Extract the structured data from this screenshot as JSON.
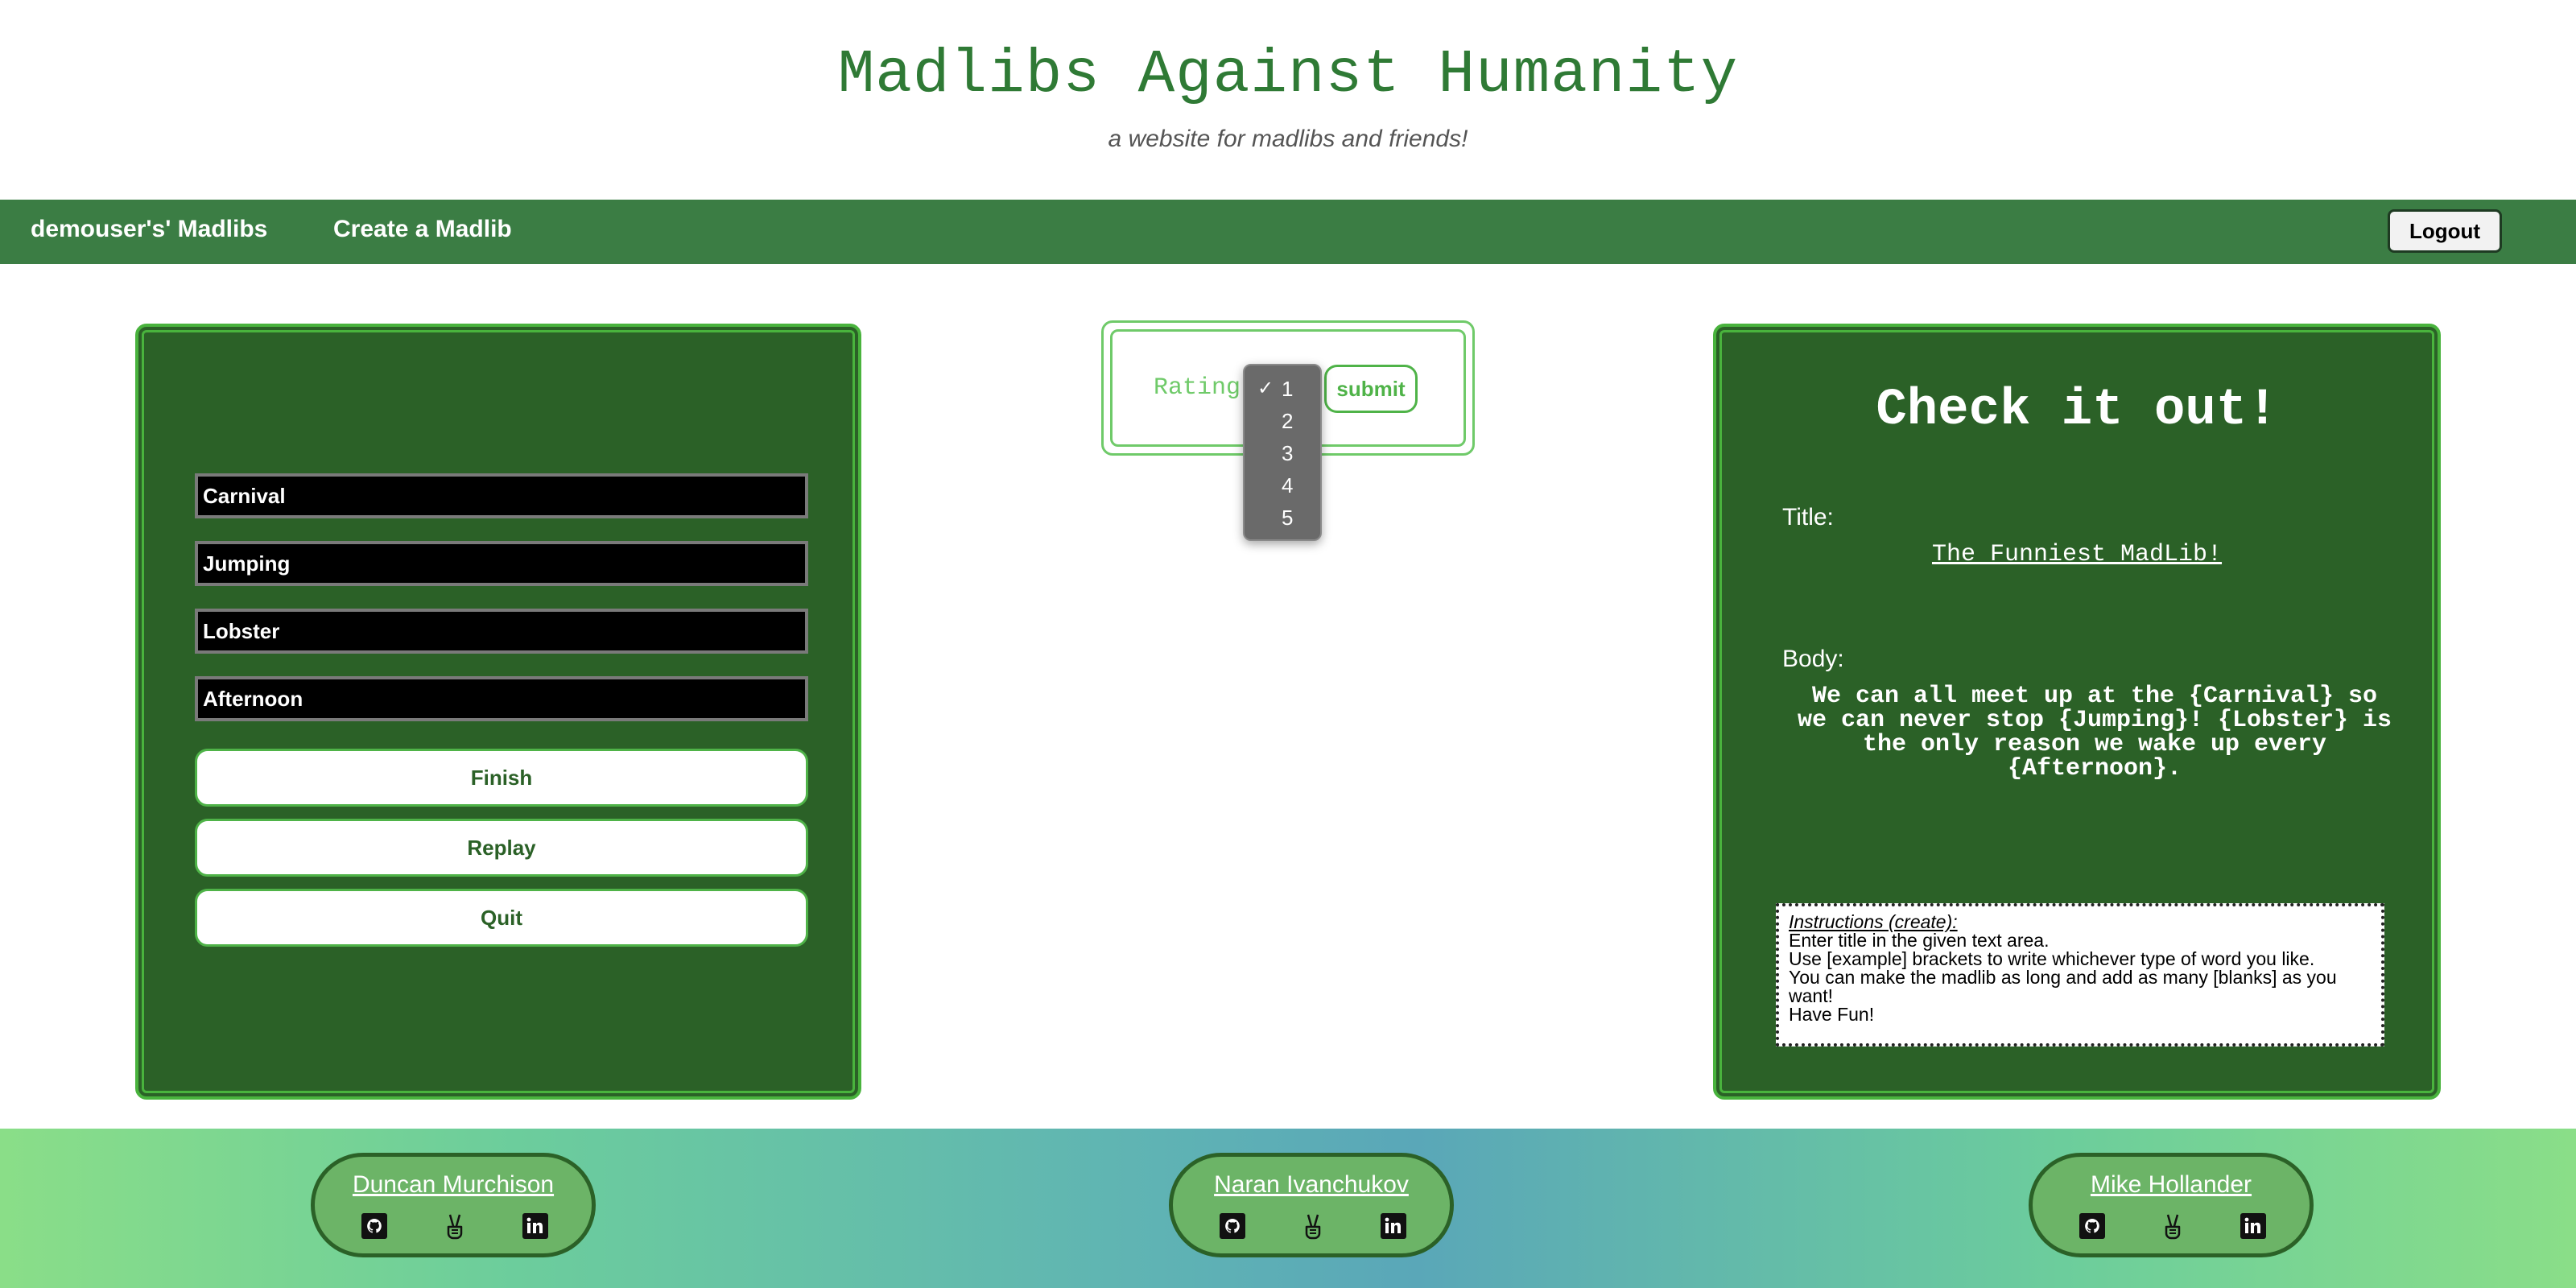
{
  "header": {
    "title": "Madlibs Against Humanity",
    "subtitle": "a website for madlibs and friends!"
  },
  "nav": {
    "my_madlibs": "demouser's' Madlibs",
    "create": "Create a Madlib",
    "logout": "Logout"
  },
  "play_panel": {
    "words": [
      "Carnival",
      "Jumping",
      "Lobster",
      "Afternoon"
    ],
    "finish": "Finish",
    "replay": "Replay",
    "quit": "Quit"
  },
  "rating": {
    "label": "Rating",
    "submit": "submit",
    "options": [
      "1",
      "2",
      "3",
      "4",
      "5"
    ],
    "selected": "1",
    "checkmark": "✓"
  },
  "preview_panel": {
    "heading": "Check it out!",
    "title_label": "Title:",
    "title_value": "The Funniest MadLib!",
    "body_label": "Body:",
    "body_text": "We can all meet up at the {Carnival} so we can never stop {Jumping}! {Lobster} is the only reason we wake up every {Afternoon}.",
    "instructions": {
      "title": "Instructions (create):",
      "lines": [
        "Enter title in the given text area.",
        "Use [example] brackets to write whichever type of word you like.",
        "You can make the madlib as long and add as many [blanks] as you want!",
        "Have Fun!"
      ]
    }
  },
  "footer": {
    "people": [
      {
        "name": "Duncan Murchison"
      },
      {
        "name": "Naran Ivanchukov"
      },
      {
        "name": "Mike Hollander"
      }
    ],
    "icons": [
      "github-icon",
      "peace-hand-icon",
      "linkedin-icon"
    ]
  },
  "colors": {
    "brand_green": "#2f7a35",
    "nav_green": "#3b7d44",
    "panel_green": "#2b6127",
    "accent_green": "#4fb348"
  }
}
